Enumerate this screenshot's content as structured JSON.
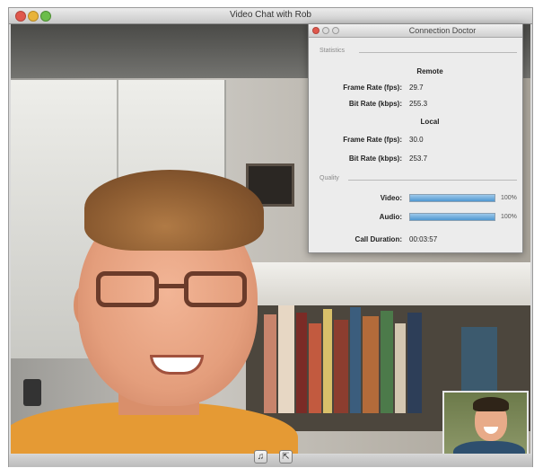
{
  "window": {
    "title": "Video Chat with Rob"
  },
  "connection_doctor": {
    "title": "Connection Doctor",
    "statistics_label": "Statistics",
    "remote_header": "Remote",
    "remote": {
      "frame_rate_label": "Frame Rate (fps):",
      "frame_rate_value": "29.7",
      "bit_rate_label": "Bit Rate (kbps):",
      "bit_rate_value": "255.3"
    },
    "local_header": "Local",
    "local": {
      "frame_rate_label": "Frame Rate (fps):",
      "frame_rate_value": "30.0",
      "bit_rate_label": "Bit Rate (kbps):",
      "bit_rate_value": "253.7"
    },
    "quality_label": "Quality",
    "video_label": "Video:",
    "video_percent": "100%",
    "video_level": 1.0,
    "audio_label": "Audio:",
    "audio_percent": "100%",
    "audio_level": 1.0,
    "call_duration_label": "Call Duration:",
    "call_duration_value": "00:03:57"
  },
  "controls": {
    "mic_icon": "microphone-icon",
    "fullscreen_icon": "fullscreen-icon"
  },
  "colors": {
    "bar_fill": "#4f97d1",
    "accent_close": "#e0584d"
  }
}
